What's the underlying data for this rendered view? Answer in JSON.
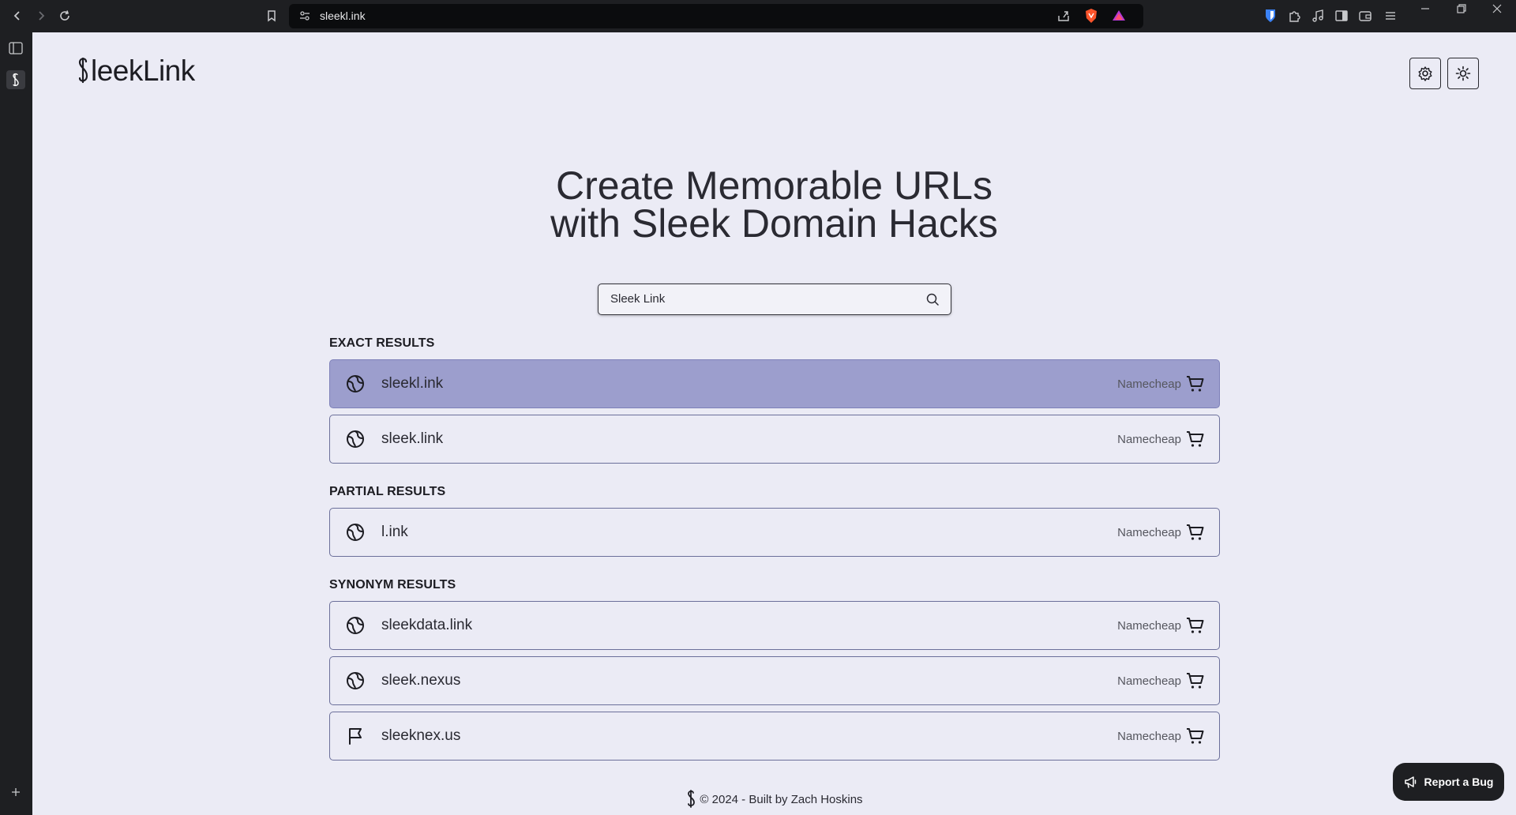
{
  "browser": {
    "url": "sleekl.ink"
  },
  "site": {
    "logo_text": "leekLink",
    "hero_line1": "Create Memorable URLs",
    "hero_line2": "with Sleek Domain Hacks"
  },
  "search": {
    "value": "Sleek Link"
  },
  "sections": {
    "exact": {
      "title": "EXACT RESULTS",
      "items": [
        {
          "domain": "sleekl.ink",
          "registrar": "Namecheap"
        },
        {
          "domain": "sleek.link",
          "registrar": "Namecheap"
        }
      ]
    },
    "partial": {
      "title": "PARTIAL RESULTS",
      "items": [
        {
          "domain": "l.ink",
          "registrar": "Namecheap"
        }
      ]
    },
    "synonym": {
      "title": "SYNONYM RESULTS",
      "items": [
        {
          "domain": "sleekdata.link",
          "registrar": "Namecheap"
        },
        {
          "domain": "sleek.nexus",
          "registrar": "Namecheap"
        },
        {
          "domain": "sleeknex.us",
          "registrar": "Namecheap"
        }
      ]
    }
  },
  "footer": {
    "text": "© 2024 - Built by Zach Hoskins"
  },
  "report_button": {
    "label": "Report a Bug"
  },
  "colors": {
    "page_bg": "#ebebf5",
    "active_row": "#9c9ecd",
    "chrome": "#1e1f22"
  }
}
